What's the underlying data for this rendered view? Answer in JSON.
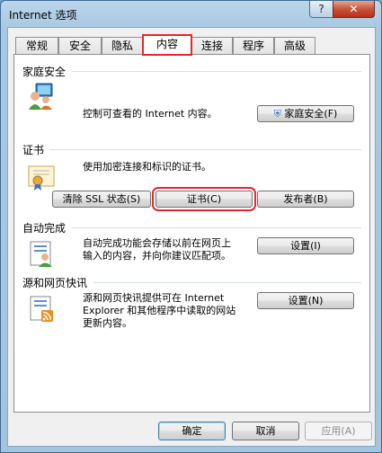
{
  "window": {
    "title": "Internet 选项",
    "help": "?",
    "close": "✕"
  },
  "tabs": [
    {
      "label": "常规"
    },
    {
      "label": "安全"
    },
    {
      "label": "隐私"
    },
    {
      "label": "内容"
    },
    {
      "label": "连接"
    },
    {
      "label": "程序"
    },
    {
      "label": "高级"
    }
  ],
  "family_safety": {
    "title": "家庭安全",
    "description": "控制可查看的 Internet 内容。",
    "button": "家庭安全(F)"
  },
  "certificates": {
    "title": "证书",
    "description": "使用加密连接和标识的证书。",
    "clear_ssl": "清除 SSL 状态(S)",
    "certificates": "证书(C)",
    "publishers": "发布者(B)"
  },
  "autocomplete": {
    "title": "自动完成",
    "description_line1": "自动完成功能会存储以前在网页上",
    "description_line2": "输入的内容，并向你建议匹配项。",
    "settings": "设置(I)"
  },
  "feeds": {
    "title": "源和网页快讯",
    "description_line1": "源和网页快讯提供可在 Internet",
    "description_line2": "Explorer 和其他程序中读取的网站",
    "description_line3": "更新内容。",
    "settings": "设置(N)"
  },
  "footer": {
    "ok": "确定",
    "cancel": "取消",
    "apply": "应用(A)"
  }
}
